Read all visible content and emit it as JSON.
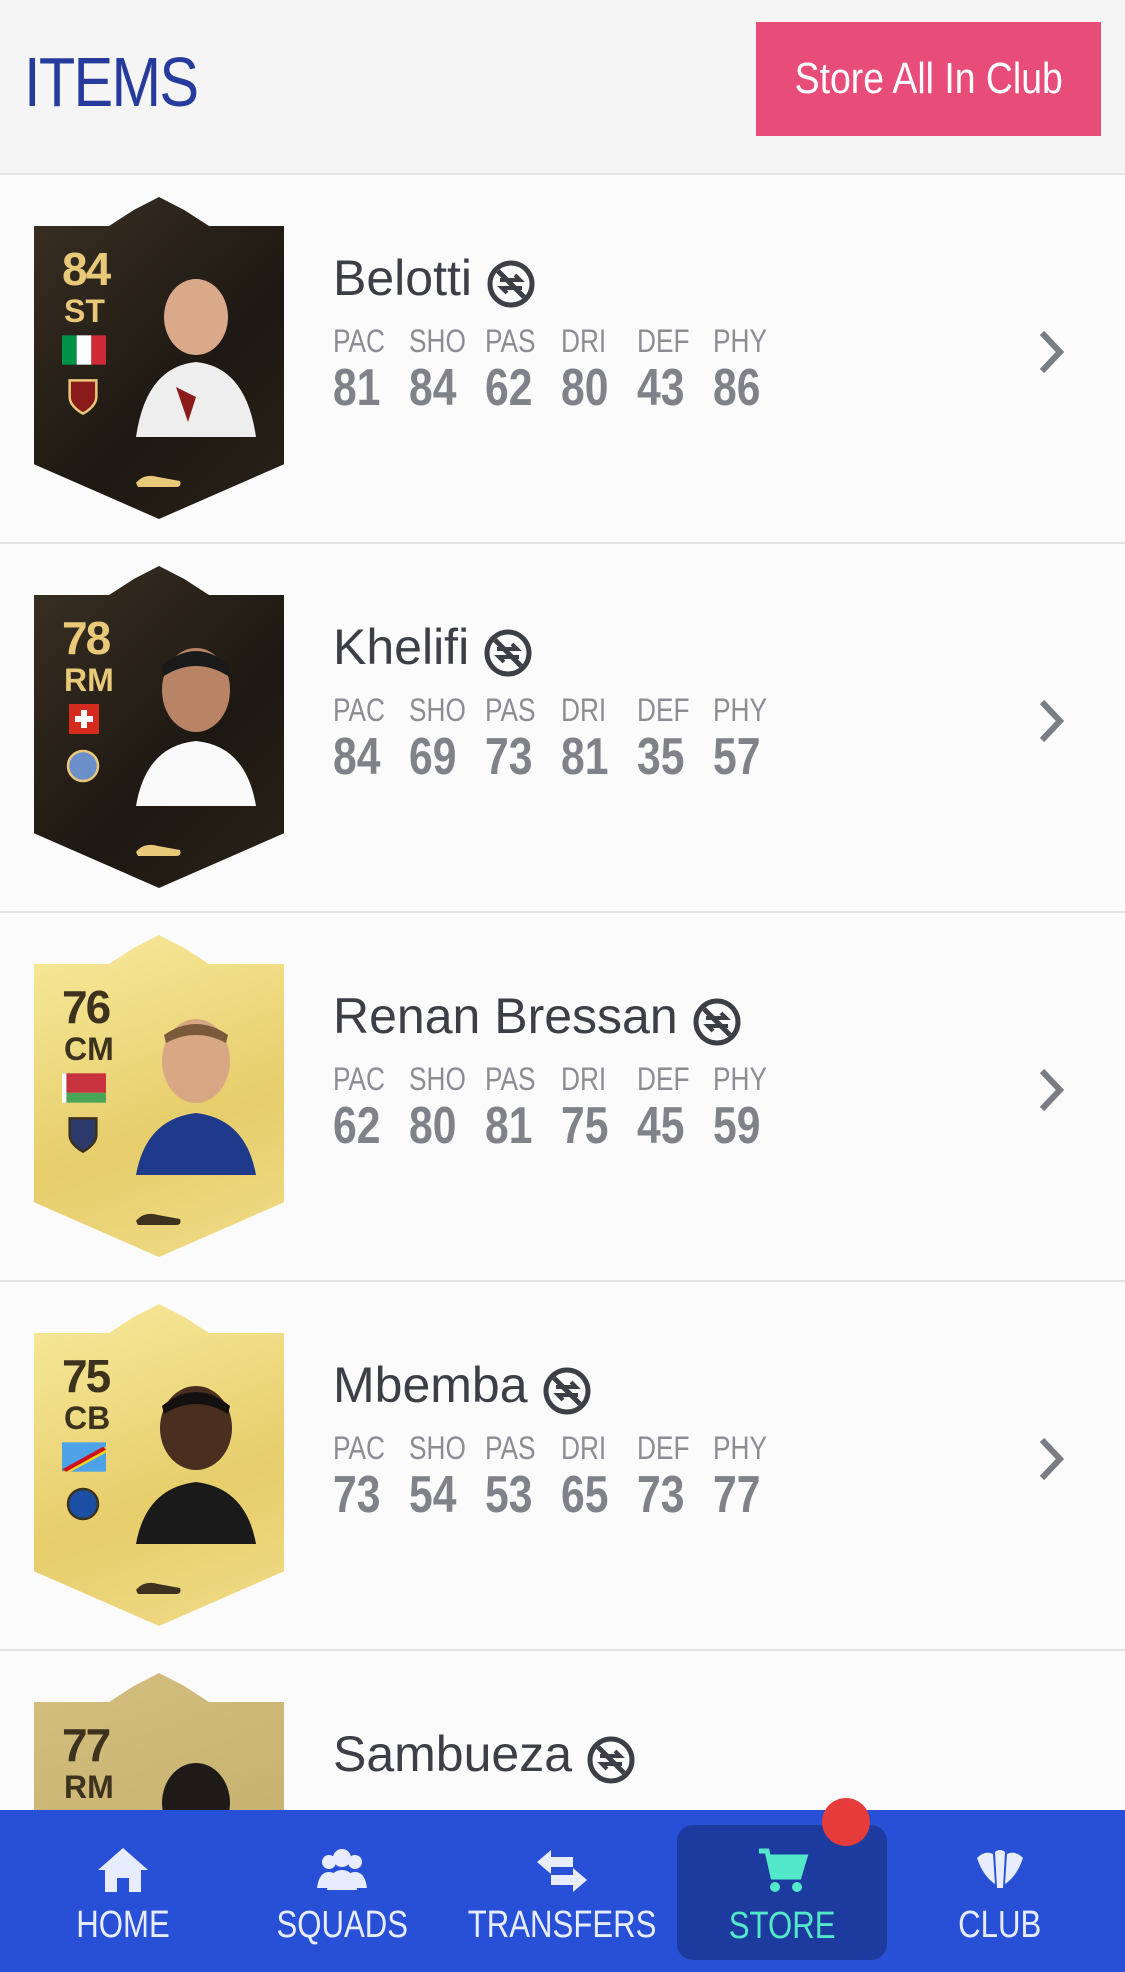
{
  "header": {
    "title": "ITEMS",
    "store_all_label": "Store All In Club"
  },
  "stat_labels": [
    "PAC",
    "SHO",
    "PAS",
    "DRI",
    "DEF",
    "PHY"
  ],
  "players": [
    {
      "name": "Belotti",
      "rating": "84",
      "position": "ST",
      "card_style": "dark",
      "stats": [
        "81",
        "84",
        "62",
        "80",
        "43",
        "86"
      ]
    },
    {
      "name": "Khelifi",
      "rating": "78",
      "position": "RM",
      "card_style": "dark",
      "stats": [
        "84",
        "69",
        "73",
        "81",
        "35",
        "57"
      ]
    },
    {
      "name": "Renan Bressan",
      "rating": "76",
      "position": "CM",
      "card_style": "gold",
      "stats": [
        "62",
        "80",
        "81",
        "75",
        "45",
        "59"
      ]
    },
    {
      "name": "Mbemba",
      "rating": "75",
      "position": "CB",
      "card_style": "gold",
      "stats": [
        "73",
        "54",
        "53",
        "65",
        "73",
        "77"
      ]
    },
    {
      "name": "Sambueza",
      "rating": "77",
      "position": "RM",
      "card_style": "bronze",
      "stats": [
        "",
        "",
        "",
        "",
        "",
        ""
      ]
    }
  ],
  "nav": {
    "items": [
      {
        "label": "HOME",
        "icon": "home-icon"
      },
      {
        "label": "SQUADS",
        "icon": "squads-icon"
      },
      {
        "label": "TRANSFERS",
        "icon": "transfers-icon"
      },
      {
        "label": "STORE",
        "icon": "cart-icon",
        "active": true
      },
      {
        "label": "CLUB",
        "icon": "club-icon"
      }
    ]
  },
  "colors": {
    "accent": "#e84c78",
    "nav_bg": "#2850d6",
    "active_label": "#52e8c9",
    "title": "#263b9c"
  }
}
